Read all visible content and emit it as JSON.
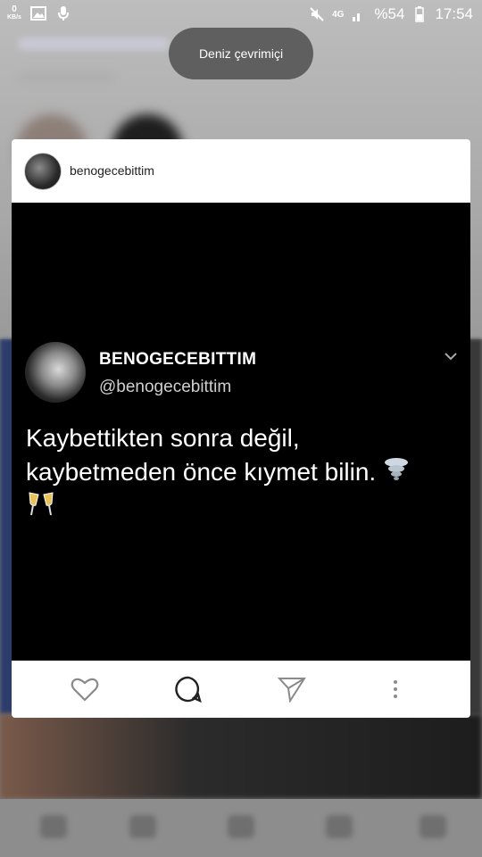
{
  "status_bar": {
    "speed_value": "0",
    "speed_unit": "KB/s",
    "network": "4G",
    "battery": "%54",
    "time": "17:54"
  },
  "toast": {
    "text": "Deniz çevrimiçi"
  },
  "post": {
    "username": "benogecebittim",
    "image": {
      "display_name": "BENOGECEBITTIM",
      "handle": "@benogecebittim",
      "text": "Kaybettikten sonra değil, kaybetmeden önce kıymet bilin."
    }
  },
  "icons": {
    "image": "image-icon",
    "mic": "mic-icon",
    "mute": "mute-icon",
    "signal": "signal-icon",
    "battery": "battery-icon",
    "like": "heart-icon",
    "comment": "comment-icon",
    "share": "send-icon",
    "more": "more-vertical-icon"
  }
}
